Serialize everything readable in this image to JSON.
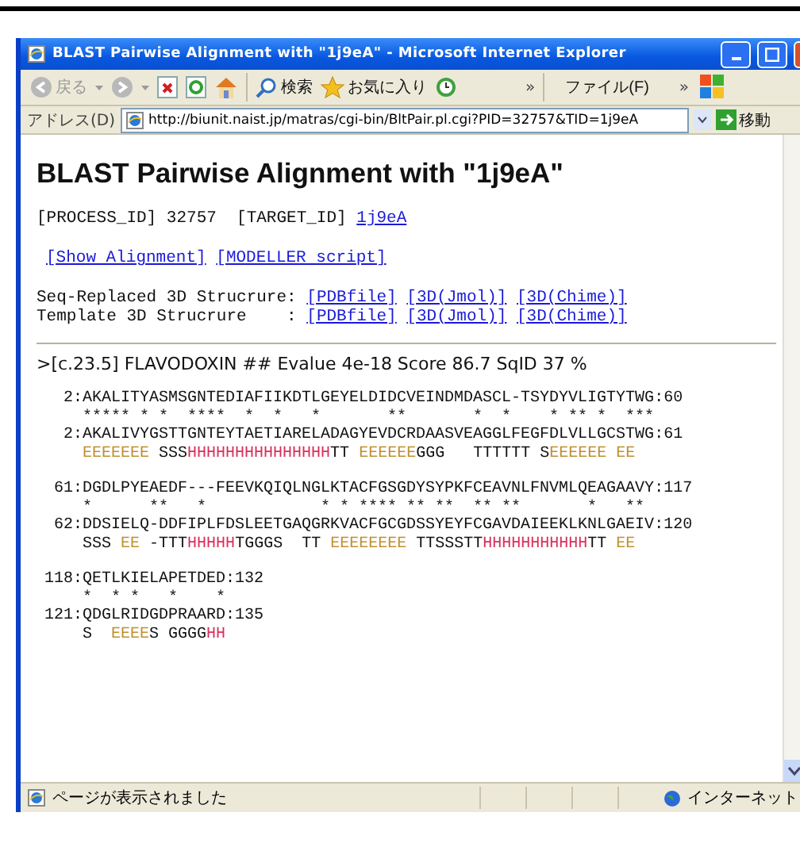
{
  "window": {
    "title": "BLAST Pairwise Alignment with \"1j9eA\" - Microsoft Internet Explorer"
  },
  "toolbar": {
    "back": "戻る",
    "search": "検索",
    "favorites": "お気に入り",
    "chevron": "»",
    "menu": "ファイル(F)",
    "menu_chevron": "»"
  },
  "address_bar": {
    "label": "アドレス(D)",
    "url": "http://biunit.naist.jp/matras/cgi-bin/BltPair.pl.cgi?PID=32757&TID=1j9eA",
    "go": "移動"
  },
  "page": {
    "heading": "BLAST Pairwise Alignment with \"1j9eA\"",
    "ids": {
      "text": "[PROCESS_ID] 32757  [TARGET_ID] ",
      "link": "1j9eA"
    },
    "links": [
      "[Show Alignment]",
      "[MODELLER script]"
    ],
    "structures": [
      {
        "label": "Seq-Replaced 3D Strucrure:",
        "links": [
          "[PDBfile]",
          "[3D(Jmol)]",
          "[3D(Chime)]"
        ]
      },
      {
        "label": "Template 3D Strucrure    :",
        "links": [
          "[PDBfile]",
          "[3D(Jmol)]",
          "[3D(Chime)]"
        ]
      }
    ],
    "hit": ">[c.23.5] FLAVODOXIN ## Evalue 4e-18 Score 86.7 SqID 37 %",
    "blocks": [
      {
        "query": "  2:AKALITYASMSGNTEDIAFIIKDTLGEYELDIDCVEINDMDASCL-TSYDYVLIGTYTWG:60",
        "match": "***** * *  ****  *  *   *       **       *  *    * ** *  ***",
        "target": "  2:AKALIVYGSTTGNTEYTAETIARELADAGYEVDCRDAASVEAGGLFEGFDLVLLGCSTWG:61",
        "ss": [
          {
            "text": "EEEEEEE",
            "kind": "strand"
          },
          {
            "text": " SSS",
            "kind": "coil"
          },
          {
            "text": "HHHHHHHHHHHHHHH",
            "kind": "helix"
          },
          {
            "text": "TT ",
            "kind": "coil"
          },
          {
            "text": "EEEEEE",
            "kind": "strand"
          },
          {
            "text": "GGG   TTTTTT S",
            "kind": "coil"
          },
          {
            "text": "EEEEEE EE",
            "kind": "strand"
          }
        ]
      },
      {
        "query": " 61:DGDLPYEAEDF---FEEVKQIQLNGLKTACFGSGDYSYPKFCEAVNLFNVMLQEAGAAVY:117",
        "match": "*      **   *            * * **** ** **  ** **       *   **",
        "target": " 62:DDSIELQ-DDFIPLFDSLEETGAQGRKVACFGCGDSSYEYFCGAVDAIEEKLKNLGAEIV:120",
        "ss": [
          {
            "text": "SSS ",
            "kind": "coil"
          },
          {
            "text": "EE",
            "kind": "strand"
          },
          {
            "text": " -TTT",
            "kind": "coil"
          },
          {
            "text": "HHHHH",
            "kind": "helix"
          },
          {
            "text": "TGGGS  TT ",
            "kind": "coil"
          },
          {
            "text": "EEEEEEEE",
            "kind": "strand"
          },
          {
            "text": " TTSSSTT",
            "kind": "coil"
          },
          {
            "text": "HHHHHHHHHHH",
            "kind": "helix"
          },
          {
            "text": "TT ",
            "kind": "coil"
          },
          {
            "text": "EE",
            "kind": "strand"
          }
        ]
      },
      {
        "query": "118:QETLKIELAPETDED:132",
        "match": "*  * *   *    *",
        "target": "121:QDGLRIDGDPRAARD:135",
        "ss": [
          {
            "text": "S  ",
            "kind": "coil"
          },
          {
            "text": "EEEE",
            "kind": "strand"
          },
          {
            "text": "S GGGG",
            "kind": "coil"
          },
          {
            "text": "HH",
            "kind": "helix"
          }
        ]
      }
    ]
  },
  "status_bar": {
    "text": "ページが表示されました",
    "zone": "インターネット"
  }
}
